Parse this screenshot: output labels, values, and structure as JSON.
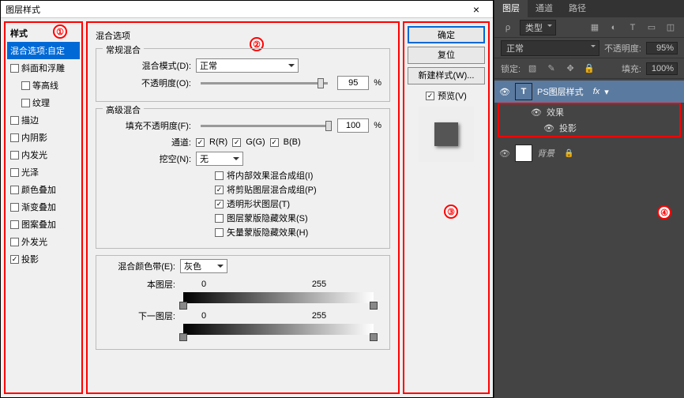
{
  "dialog": {
    "title": "图层样式",
    "styles_header": "样式",
    "styles": [
      {
        "label": "混合选项:自定",
        "selected": true,
        "hasCheck": false
      },
      {
        "label": "斜面和浮雕",
        "checked": false
      },
      {
        "label": "等高线",
        "checked": false,
        "indent": true
      },
      {
        "label": "纹理",
        "checked": false,
        "indent": true
      },
      {
        "label": "描边",
        "checked": false
      },
      {
        "label": "内阴影",
        "checked": false
      },
      {
        "label": "内发光",
        "checked": false
      },
      {
        "label": "光泽",
        "checked": false
      },
      {
        "label": "颜色叠加",
        "checked": false
      },
      {
        "label": "渐变叠加",
        "checked": false
      },
      {
        "label": "图案叠加",
        "checked": false
      },
      {
        "label": "外发光",
        "checked": false
      },
      {
        "label": "投影",
        "checked": true
      }
    ],
    "options_title": "混合选项",
    "general": {
      "legend": "常规混合",
      "blend_label": "混合模式(D):",
      "blend_value": "正常",
      "opacity_label": "不透明度(O):",
      "opacity_value": "95",
      "pct": "%"
    },
    "advanced": {
      "legend": "高级混合",
      "fill_label": "填充不透明度(F):",
      "fill_value": "100",
      "pct": "%",
      "channel_label": "通道:",
      "ch_r": "R(R)",
      "ch_g": "G(G)",
      "ch_b": "B(B)",
      "knockout_label": "挖空(N):",
      "knockout_value": "无",
      "c1": "将内部效果混合成组(I)",
      "c2": "将剪贴图层混合成组(P)",
      "c3": "透明形状图层(T)",
      "c4": "图层蒙版隐藏效果(S)",
      "c5": "矢量蒙版隐藏效果(H)"
    },
    "blendif": {
      "legend_label": "混合颜色带(E):",
      "legend_value": "灰色",
      "this_label": "本图层:",
      "under_label": "下一图层:",
      "v0": "0",
      "v255": "255"
    },
    "buttons": {
      "ok": "确定",
      "reset": "复位",
      "new": "新建样式(W)...",
      "preview": "预览(V)"
    }
  },
  "panel": {
    "tabs": [
      "图层",
      "通道",
      "路径"
    ],
    "kind": "类型",
    "mode": "正常",
    "opacity_label": "不透明度:",
    "opacity": "95%",
    "lock_label": "锁定:",
    "fill_label": "填充:",
    "fill": "100%",
    "layer_text": "PS图层样式",
    "fx": "fx",
    "effects": "效果",
    "dropshadow": "投影",
    "bg": "背景"
  }
}
